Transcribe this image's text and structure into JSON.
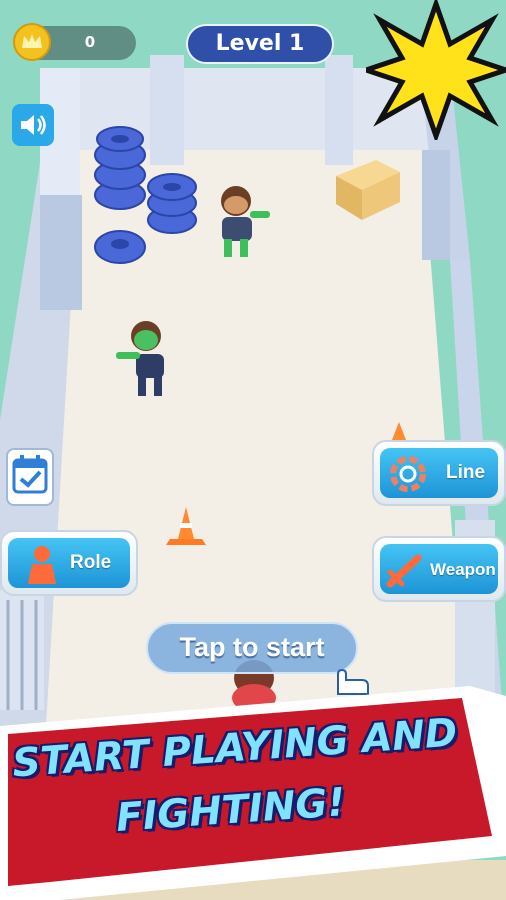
{
  "hud": {
    "coins": "0",
    "level": "Level 1"
  },
  "buttons": {
    "line_label": "Line",
    "role_label": "Role",
    "weapon_label": "Weapon",
    "tap_to_start": "Tap to start"
  },
  "banner": {
    "line1": "START PLAYING AND",
    "line2": "FIGHTING!"
  },
  "colors": {
    "background": "#8fd9c4",
    "floor": "#f3eee6",
    "button_blue": "#2ba8e8",
    "banner_red": "#c8192b",
    "starburst": "#ffe21a"
  },
  "icons": {
    "coin": "crown-coin-icon",
    "sound": "speaker-icon",
    "calendar": "calendar-check-icon",
    "line": "rope-coil-icon",
    "role": "person-icon",
    "weapon": "sword-icon",
    "pointer": "hand-pointer-icon"
  }
}
